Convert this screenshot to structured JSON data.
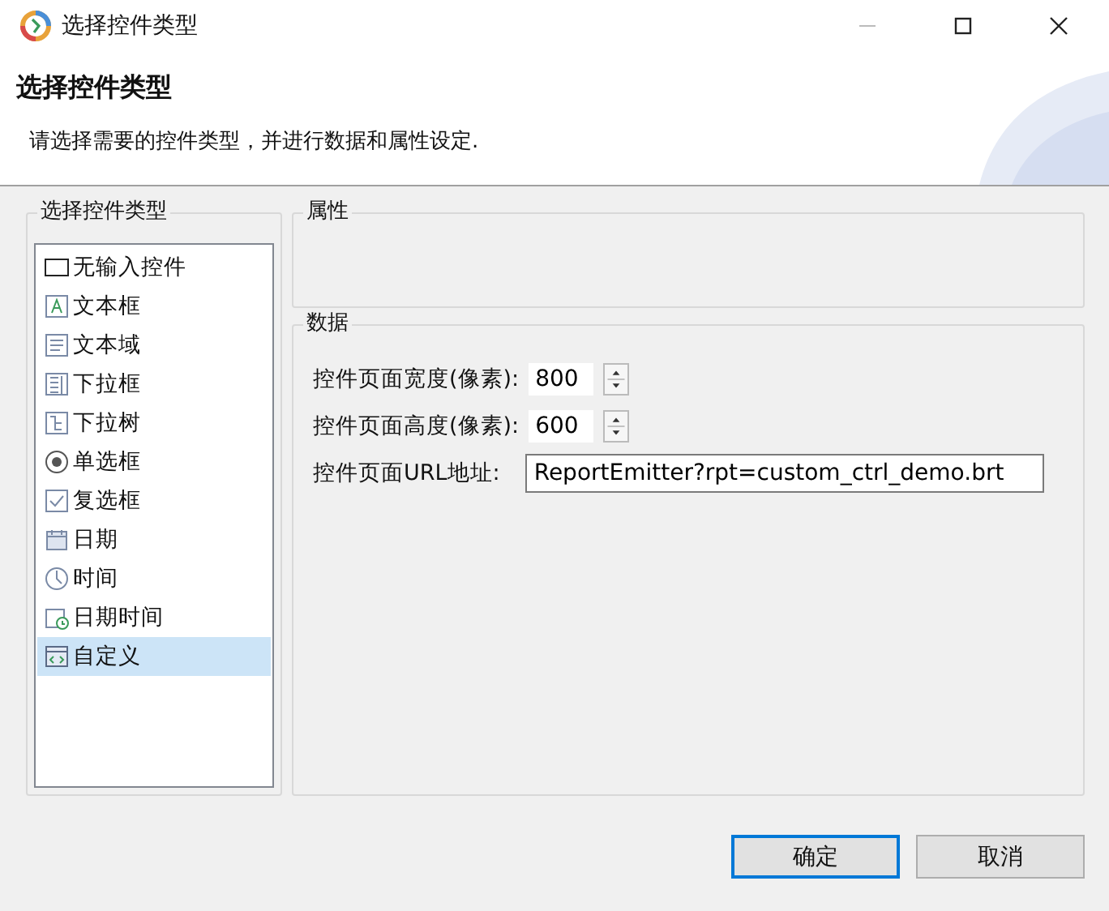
{
  "window": {
    "title": "选择控件类型"
  },
  "header": {
    "title": "选择控件类型",
    "description": "请选择需要的控件类型，并进行数据和属性设定."
  },
  "type_group": {
    "label": "选择控件类型",
    "items": [
      {
        "label": "无输入控件",
        "kind": "none",
        "selected": false
      },
      {
        "label": "文本框",
        "kind": "textbox",
        "selected": false
      },
      {
        "label": "文本域",
        "kind": "textarea",
        "selected": false
      },
      {
        "label": "下拉框",
        "kind": "dropdown",
        "selected": false
      },
      {
        "label": "下拉树",
        "kind": "tree",
        "selected": false
      },
      {
        "label": "单选框",
        "kind": "radio",
        "selected": false
      },
      {
        "label": "复选框",
        "kind": "checkbox",
        "selected": false
      },
      {
        "label": "日期",
        "kind": "date",
        "selected": false
      },
      {
        "label": "时间",
        "kind": "time",
        "selected": false
      },
      {
        "label": "日期时间",
        "kind": "datetime",
        "selected": false
      },
      {
        "label": "自定义",
        "kind": "custom",
        "selected": true
      }
    ]
  },
  "properties_group": {
    "label": "属性"
  },
  "data_group": {
    "label": "数据",
    "fields": [
      {
        "label": "控件页面宽度(像素):",
        "value": "800",
        "kind": "spinner"
      },
      {
        "label": "控件页面高度(像素):",
        "value": "600",
        "kind": "spinner"
      },
      {
        "label": "控件页面URL地址:",
        "value": "ReportEmitter?rpt=custom_ctrl_demo.brt",
        "kind": "text"
      }
    ]
  },
  "buttons": [
    {
      "label": "确定",
      "default": true
    },
    {
      "label": "取消",
      "default": false
    }
  ]
}
